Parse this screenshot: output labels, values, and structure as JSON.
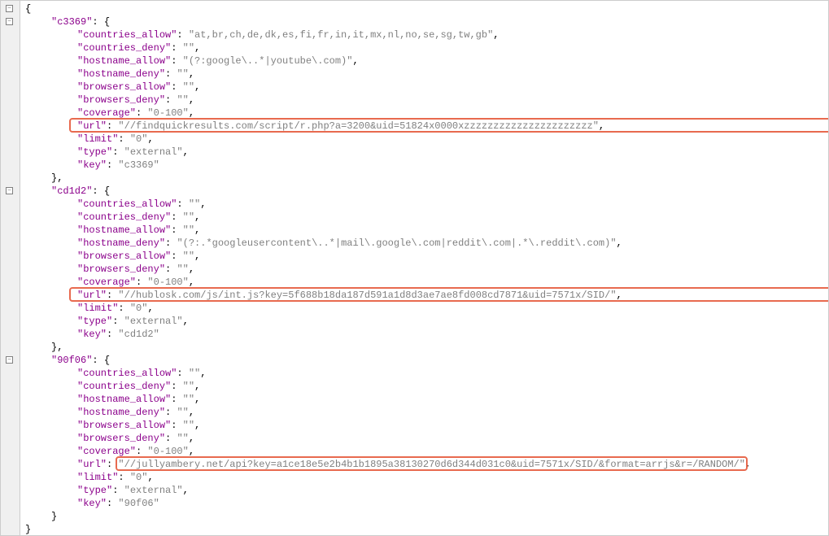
{
  "entries": [
    {
      "id": "c3369",
      "fields": {
        "countries_allow": "at,br,ch,de,dk,es,fi,fr,in,it,mx,nl,no,se,sg,tw,gb",
        "countries_deny": "",
        "hostname_allow": "(?:google\\..*|youtube\\.com)",
        "hostname_deny": "",
        "browsers_allow": "",
        "browsers_deny": "",
        "coverage": "0-100",
        "url": "//findquickresults.com/script/r.php?a=3200&uid=51824x0000xzzzzzzzzzzzzzzzzzzzzzz",
        "limit": "0",
        "type": "external",
        "key": "c3369"
      },
      "highlight": "url_line"
    },
    {
      "id": "cd1d2",
      "fields": {
        "countries_allow": "",
        "countries_deny": "",
        "hostname_allow": "",
        "hostname_deny": "(?:.*googleusercontent\\..*|mail\\.google\\.com|reddit\\.com|.*\\.reddit\\.com)",
        "browsers_allow": "",
        "browsers_deny": "",
        "coverage": "0-100",
        "url": "//hublosk.com/js/int.js?key=5f688b18da187d591a1d8d3ae7ae8fd008cd7871&uid=7571x/SID/",
        "limit": "0",
        "type": "external",
        "key": "cd1d2"
      },
      "highlight": "url_line"
    },
    {
      "id": "90f06",
      "fields": {
        "countries_allow": "",
        "countries_deny": "",
        "hostname_allow": "",
        "hostname_deny": "",
        "browsers_allow": "",
        "browsers_deny": "",
        "coverage": "0-100",
        "url": "//jullyambery.net/api?key=a1ce18e5e2b4b1b1895a38130270d6d344d031c0&uid=7571x/SID/&format=arrjs&r=/RANDOM/",
        "limit": "0",
        "type": "external",
        "key": "90f06"
      },
      "highlight": "url_value"
    }
  ],
  "fold_symbol": "−"
}
